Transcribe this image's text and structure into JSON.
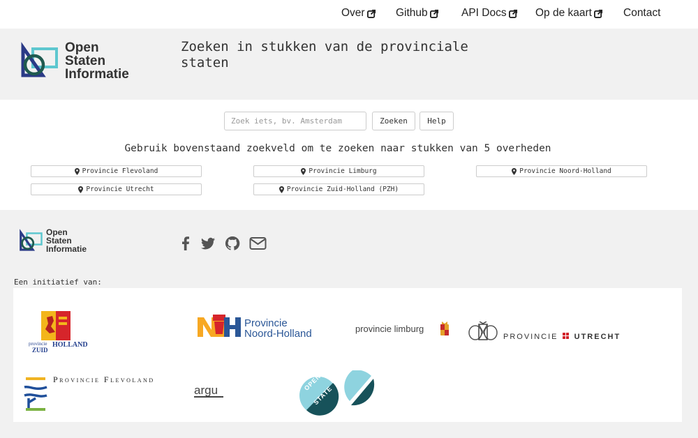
{
  "nav": {
    "links": [
      {
        "label": "Over",
        "external": true
      },
      {
        "label": "Github",
        "external": true
      },
      {
        "label": "API Docs",
        "external": true
      },
      {
        "label": "Op de kaart",
        "external": true
      },
      {
        "label": "Contact",
        "external": false
      }
    ]
  },
  "header": {
    "logo_lines": [
      "Open",
      "Staten",
      "Informatie"
    ],
    "tagline": "Zoeken in stukken van de provinciale staten"
  },
  "search": {
    "placeholder": "Zoek iets, bv. Amsterdam",
    "value": "",
    "search_button": "Zoeken",
    "help_button": "Help"
  },
  "info_text": "Gebruik bovenstaand zoekveld om te zoeken naar stukken van 5 overheden",
  "provinces": [
    "Provincie Flevoland",
    "Provincie Limburg",
    "Provincie Noord-Holland",
    "Provincie Utrecht",
    "Provincie Zuid-Holland (PZH)"
  ],
  "footer": {
    "logo_lines": [
      "Open",
      "Staten",
      "Informatie"
    ],
    "initiative_label": "Een initiatief van:",
    "sponsors": {
      "zuid_holland": [
        "provincie",
        "ZUID",
        "HOLLAND"
      ],
      "noord_holland": [
        "Provincie",
        "Noord-Holland"
      ],
      "limburg": "provincie limburg",
      "utrecht": [
        "PROVINCIE",
        "UTRECHT"
      ],
      "flevoland": "Provincie Flevoland",
      "argu": "argu",
      "open_state": [
        "OPEN",
        "STATE"
      ]
    }
  },
  "colors": {
    "logo_navy": "#2a3a86",
    "logo_teal": "#5ec7cf",
    "logo_dark": "#1f5a4f",
    "header_bg": "#f1f1f1",
    "nh_orange": "#f7a823",
    "nh_blue": "#2b5797",
    "utrecht_red": "#d2232a",
    "openstate_light": "#8ed3df",
    "openstate_dark": "#17525a"
  }
}
